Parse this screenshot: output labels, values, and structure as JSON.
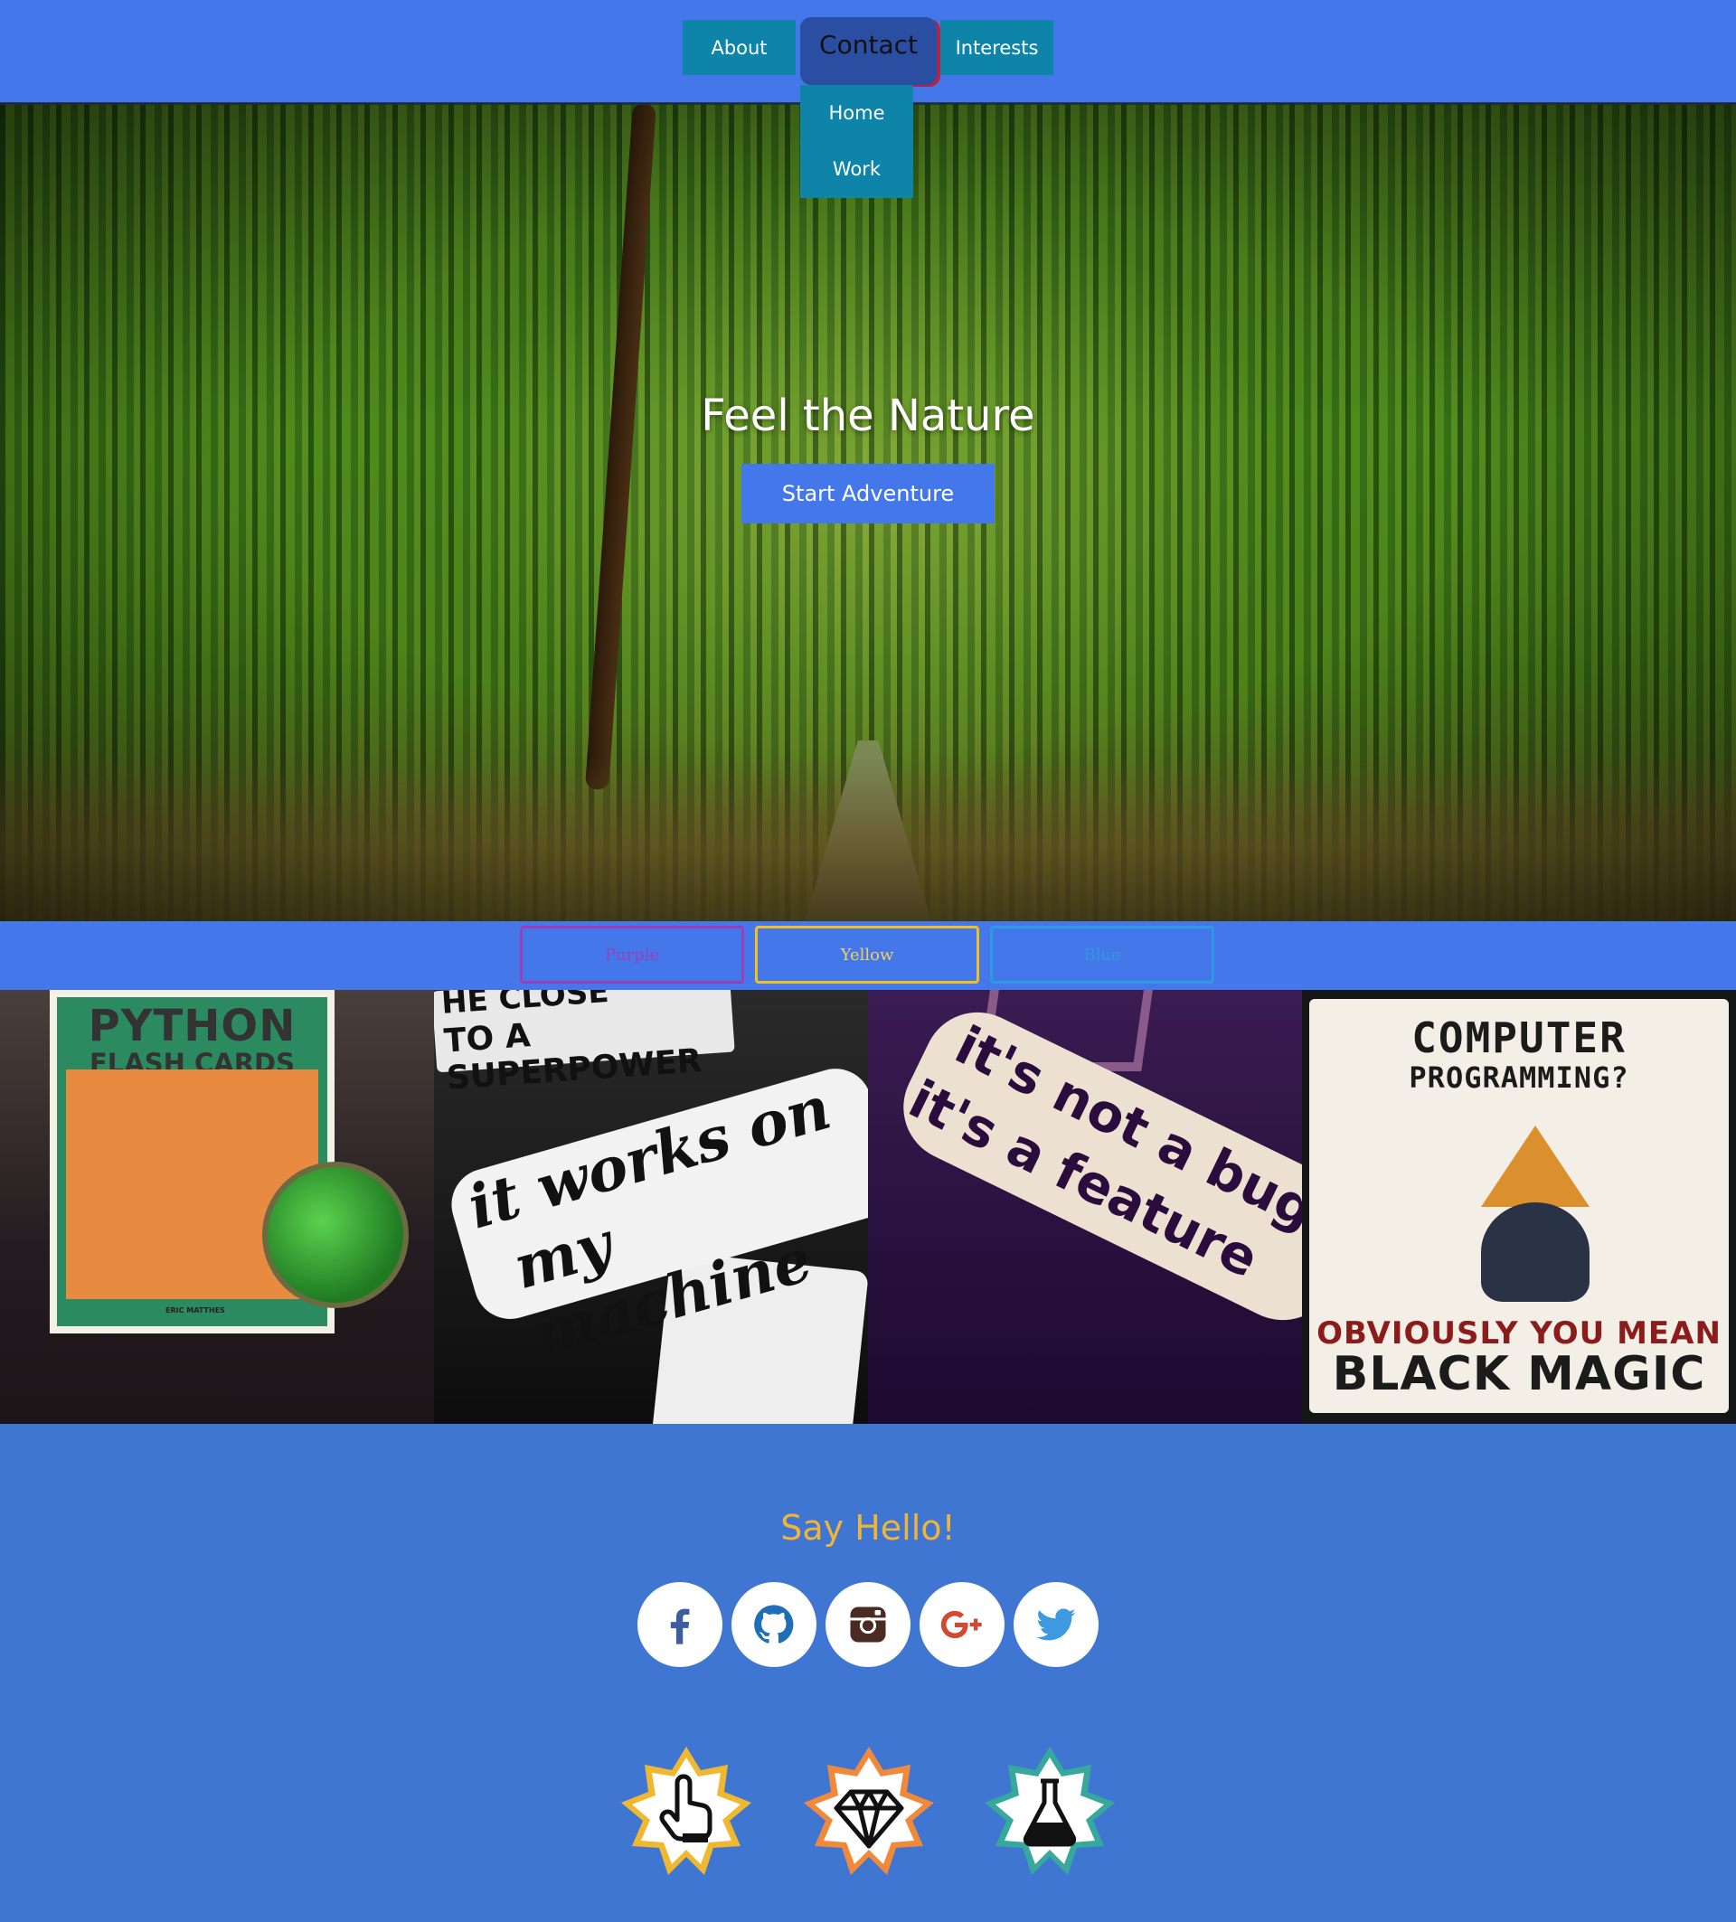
{
  "nav": {
    "about": "About",
    "contact": "Contact",
    "interests": "Interests",
    "dropdown": [
      "Home",
      "Work"
    ]
  },
  "hero": {
    "title": "Feel the Nature",
    "button": "Start Adventure"
  },
  "filters": {
    "purple": "Purple",
    "yellow": "Yellow",
    "blue": "Blue"
  },
  "gallery": {
    "python": {
      "line1": "PYTHON",
      "line2": "FLASH CARDS",
      "author": "ERIC MATTHES"
    },
    "works": {
      "top1": "HE CLOSE",
      "top2": "TO A SUPERPOWER",
      "main1": "it works on",
      "main2": "my machine"
    },
    "bug": {
      "line1": "it's not a bug",
      "line2": "it's a feature"
    },
    "magic": {
      "line1": "COMPUTER",
      "line2": "PROGRAMMING?",
      "line3": "OBVIOUSLY YOU MEAN",
      "line4": "BLACK MAGIC"
    }
  },
  "footer": {
    "say_hello": "Say Hello!",
    "socials": [
      "facebook-icon",
      "github-icon",
      "instagram-icon",
      "google-plus-icon",
      "twitter-icon"
    ],
    "badges": [
      "touch-icon",
      "diamond-icon",
      "flask-icon"
    ]
  },
  "colors": {
    "nav_bg": "#4478ea",
    "page_bg": "#3f76d2",
    "teal_button": "#0d84a8",
    "accent_yellow": "#f0b43a"
  }
}
